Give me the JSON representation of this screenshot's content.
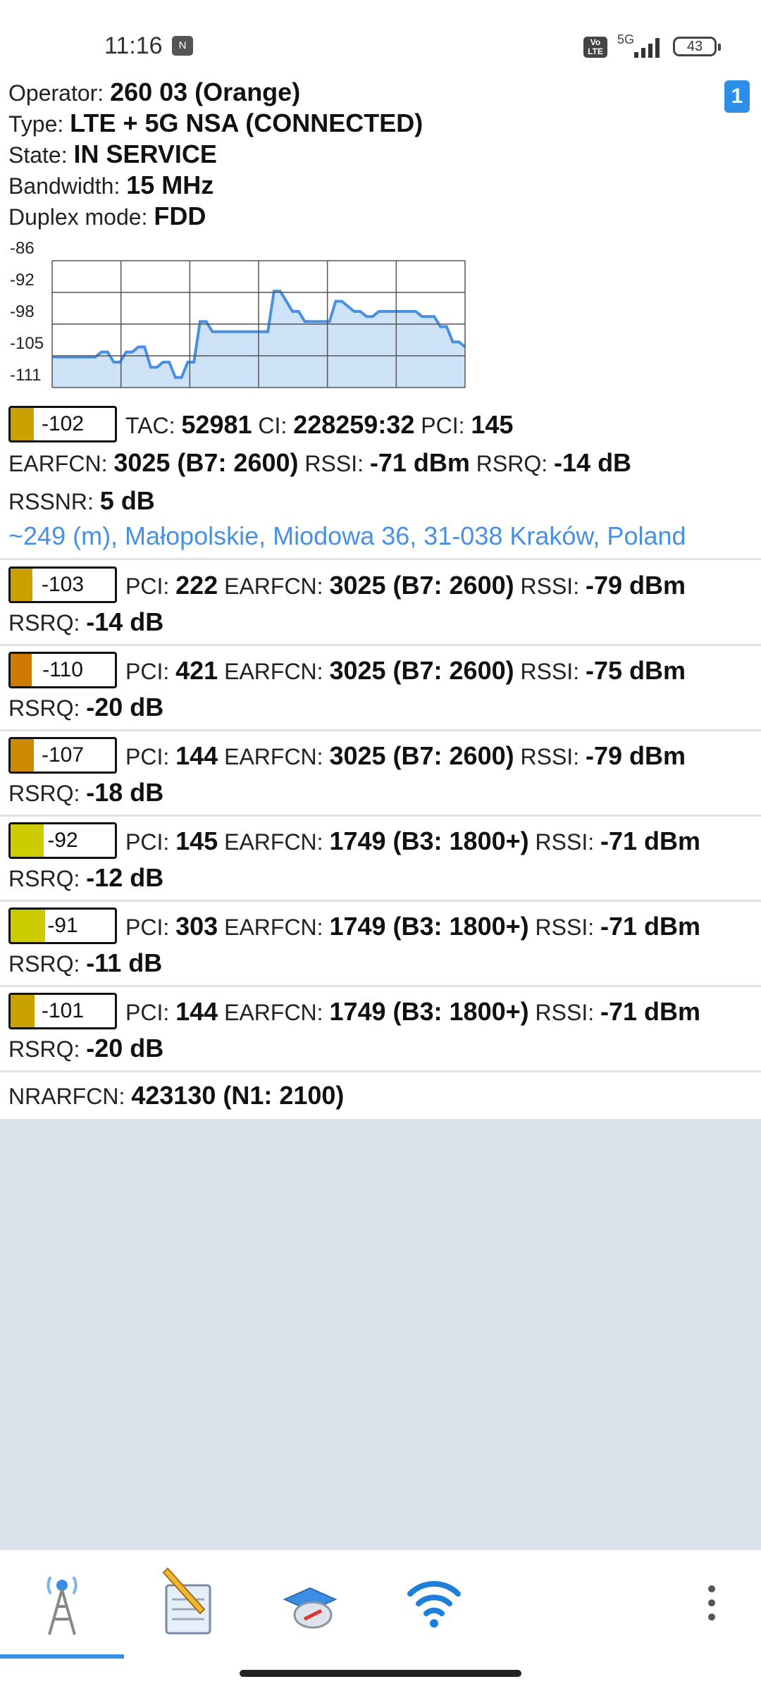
{
  "status_bar": {
    "time": "11:16",
    "nfc_icon": "N",
    "volte": "Vo LTE",
    "network": "5G",
    "battery": "43"
  },
  "sim_badge": "1",
  "info": {
    "operator_label": "Operator:",
    "operator_value": "260 03 (Orange)",
    "type_label": "Type:",
    "type_value": "LTE + 5G NSA (CONNECTED)",
    "state_label": "State:",
    "state_value": "IN SERVICE",
    "bandwidth_label": "Bandwidth:",
    "bandwidth_value": "15 MHz",
    "duplex_label": "Duplex mode:",
    "duplex_value": "FDD"
  },
  "chart_data": {
    "type": "area",
    "title": "",
    "xlabel": "",
    "ylabel": "",
    "y_ticks": [
      "-86",
      "-92",
      "-98",
      "-105",
      "-111"
    ],
    "ylim": [
      -111,
      -86
    ],
    "grid": true,
    "color": "#4a90e2",
    "fill_color": "#cfe3f8",
    "series": [
      {
        "values": [
          -105,
          -105,
          -105,
          -105,
          -105,
          -105,
          -105,
          -105,
          -104,
          -104,
          -106,
          -106,
          -104,
          -104,
          -103,
          -103,
          -107,
          -107,
          -106,
          -106,
          -109,
          -109,
          -106,
          -106,
          -98,
          -98,
          -100,
          -100,
          -100,
          -100,
          -100,
          -100,
          -100,
          -100,
          -100,
          -100,
          -92,
          -92,
          -94,
          -96,
          -96,
          -98,
          -98,
          -98,
          -98,
          -98,
          -94,
          -94,
          -95,
          -96,
          -96,
          -97,
          -97,
          -96,
          -96,
          -96,
          -96,
          -96,
          -96,
          -96,
          -97,
          -97,
          -97,
          -99,
          -99,
          -102,
          -102,
          -103
        ]
      }
    ]
  },
  "serving_cell": {
    "signal": "-102",
    "signal_level": 0.22,
    "color": "#c9a100",
    "tac_label": "TAC:",
    "tac_value": "52981",
    "ci_label": "CI:",
    "ci_value": "228259:32",
    "pci_label": "PCI:",
    "pci_value": "145",
    "earfcn_label": "EARFCN:",
    "earfcn_value": "3025 (B7: 2600)",
    "rssi_label": "RSSI:",
    "rssi_value": "-71 dBm",
    "rsrq_label": "RSRQ:",
    "rsrq_value": "-14 dB",
    "rssnr_label": "RSSNR:",
    "rssnr_value": "5 dB",
    "location": "~249 (m), Małopolskie, Miodowa 36, 31-038 Kraków, Poland"
  },
  "neighbors": [
    {
      "signal": "-103",
      "signal_level": 0.21,
      "color": "#c9a100",
      "pci": "222",
      "earfcn": "3025 (B7: 2600)",
      "rssi": "-79 dBm",
      "rsrq": "-14 dB"
    },
    {
      "signal": "-110",
      "signal_level": 0.2,
      "color": "#cc7a00",
      "pci": "421",
      "earfcn": "3025 (B7: 2600)",
      "rssi": "-75 dBm",
      "rsrq": "-20 dB"
    },
    {
      "signal": "-107",
      "signal_level": 0.22,
      "color": "#cc8a00",
      "pci": "144",
      "earfcn": "3025 (B7: 2600)",
      "rssi": "-79 dBm",
      "rsrq": "-18 dB"
    },
    {
      "signal": "-92",
      "signal_level": 0.32,
      "color": "#cccc00",
      "pci": "145",
      "earfcn": "1749 (B3: 1800+)",
      "rssi": "-71 dBm",
      "rsrq": "-12 dB"
    },
    {
      "signal": "-91",
      "signal_level": 0.33,
      "color": "#cccc00",
      "pci": "303",
      "earfcn": "1749 (B3: 1800+)",
      "rssi": "-71 dBm",
      "rsrq": "-11 dB"
    },
    {
      "signal": "-101",
      "signal_level": 0.23,
      "color": "#c9a100",
      "pci": "144",
      "earfcn": "1749 (B3: 1800+)",
      "rssi": "-71 dBm",
      "rsrq": "-20 dB"
    }
  ],
  "labels": {
    "pci": "PCI:",
    "earfcn": "EARFCN:",
    "rssi": "RSSI:",
    "rsrq": "RSRQ:"
  },
  "nr": {
    "label": "NRARFCN:",
    "value": "423130 (N1: 2100)"
  },
  "nav": {
    "tabs": [
      "cell-tower-icon",
      "notepad-icon",
      "map-compass-icon",
      "wifi-icon"
    ],
    "accent": "#3a8ee6"
  }
}
